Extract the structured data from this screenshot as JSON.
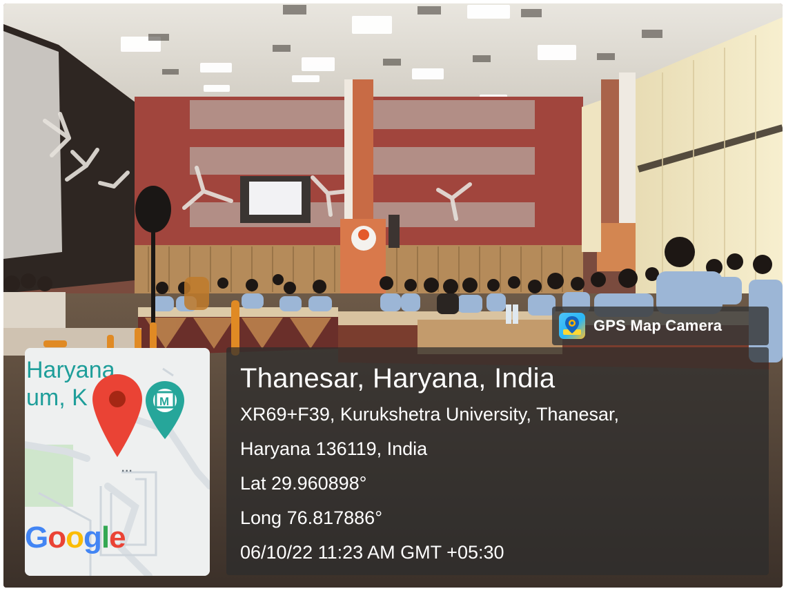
{
  "photo": {
    "description": "conference-hall-with-students"
  },
  "gps_tag": {
    "label": "GPS Map Camera",
    "icon": "map-pin-camera-icon"
  },
  "location": {
    "title": "Thanesar, Haryana, India",
    "address_line_1": "XR69+F39, Kurukshetra University, Thanesar,",
    "address_line_2": "Haryana 136119, India",
    "latitude": "Lat 29.960898°",
    "longitude": "Long 76.817886°",
    "datetime": "06/10/22 11:23 AM GMT +05:30"
  },
  "map": {
    "region_label_1": "Haryana",
    "region_label_2": "um, K",
    "pin_icon": "map-pin-icon",
    "museum_icon": "museum-marker-icon",
    "museum_glyph": "M",
    "google_logo": [
      "G",
      "o",
      "o",
      "g",
      "l",
      "e"
    ]
  },
  "colors": {
    "pin_red": "#EA4335",
    "marker_teal": "#26a69a",
    "panel_bg": "#2d2d2d"
  }
}
